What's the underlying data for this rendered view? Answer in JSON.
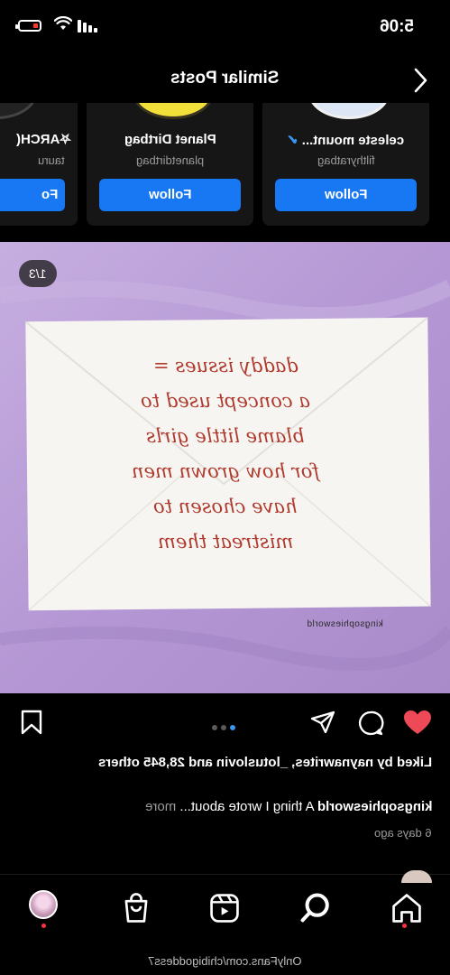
{
  "status_bar": {
    "time": "5:06"
  },
  "header": {
    "title": "Similar Posts"
  },
  "suggested_cards": [
    {
      "name": "celeste mount...",
      "verified": true,
      "handle": "filthyratbag",
      "follow_label": "Follow"
    },
    {
      "name": "Planet Dirtbag",
      "verified": false,
      "handle": "planetdirtbag",
      "follow_label": "Follow"
    },
    {
      "name": "⛧ARCH(",
      "verified": false,
      "handle": "tauru",
      "follow_label": "Fo"
    }
  ],
  "post": {
    "counter": "1/3",
    "note_lines": [
      "daddy issues =",
      "a concept used to",
      "blame little girls",
      "for how grown men",
      "have chosen to",
      "mistreat them"
    ],
    "photo_credit": "kingsophiesworld",
    "dots": 3,
    "active_dot": 2,
    "liked": true,
    "likes_text": "Liked by naynawrites, _lotuslovin and 28,845 others",
    "caption_user": "kingsophiesworld",
    "caption_text": " A thing I wrote about... ",
    "caption_more": "more",
    "date": "6 days ago"
  },
  "watermark": "OnlyFans.com/chibigoddess7",
  "colors": {
    "accent": "#1877f2",
    "like": "#ed4956",
    "photo_background": "#b79bd6",
    "ink": "#b03a2e"
  }
}
